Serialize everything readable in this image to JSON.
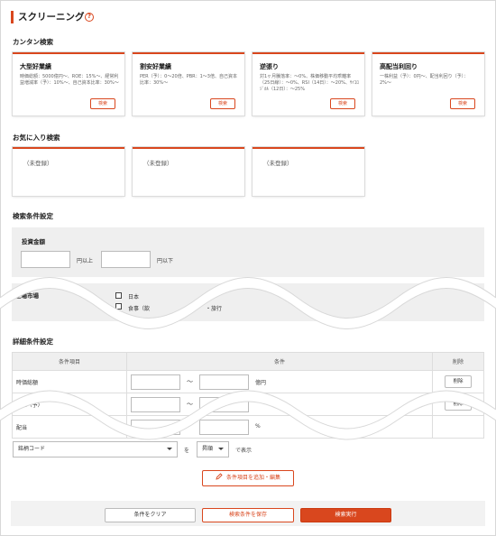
{
  "page": {
    "title": "スクリーニング",
    "help_icon": "question-circle-icon",
    "accent": "#d9471e"
  },
  "easy_search": {
    "heading": "カンタン検索",
    "cards": [
      {
        "name": "大型好業績",
        "desc": "時価総額：5000億円〜、ROE：15%〜、経常利益増減率（予）：10%〜、自己資本比率：30%〜",
        "button": "検索"
      },
      {
        "name": "割安好業績",
        "desc": "PER（予）：0〜20倍、PBR：1〜3倍、自己資本比率：30%〜",
        "button": "検索"
      },
      {
        "name": "逆張り",
        "desc": "対1ヶ月騰落率：〜0%、株価移動平均乖離率（25日線）：〜0%、RSI（14日）：〜20%、ｻｲｺﾛｼﾞｶﾙ（12日）：〜25%",
        "button": "検索"
      },
      {
        "name": "高配当利回り",
        "desc": "一株利益（予）：0円〜、配当利回り（予）：2%〜",
        "button": "検索"
      }
    ]
  },
  "favorites": {
    "heading": "お気に入り検索",
    "items": [
      "（未登録）",
      "（未登録）",
      "（未登録）"
    ]
  },
  "conditions": {
    "heading": "検索条件設定",
    "investment": {
      "label": "投資金額",
      "min_unit": "円以上",
      "max_unit": "円以下"
    },
    "market": {
      "label": "上場市場",
      "options": [
        "日本",
        "食事（飲",
        "・旅行"
      ]
    }
  },
  "detail": {
    "heading": "詳細条件設定",
    "columns": [
      "条件項目",
      "条件",
      "削除"
    ],
    "rows": [
      {
        "label": "時価総額",
        "tilde": "〜",
        "unit": "億円",
        "delete": "削除"
      },
      {
        "label": "PER（予）",
        "tilde": "〜",
        "unit": "",
        "delete": "削除"
      },
      {
        "label": "配当",
        "tilde": "",
        "unit": "%",
        "delete": ""
      }
    ]
  },
  "sort": {
    "field": "銘柄コード",
    "wo": "を",
    "order": "昇順",
    "suffix": "で表示"
  },
  "add_button": "条件項目を追加・編集",
  "footer": {
    "clear": "条件をクリア",
    "save": "検索条件を保存",
    "run": "検索実行"
  }
}
